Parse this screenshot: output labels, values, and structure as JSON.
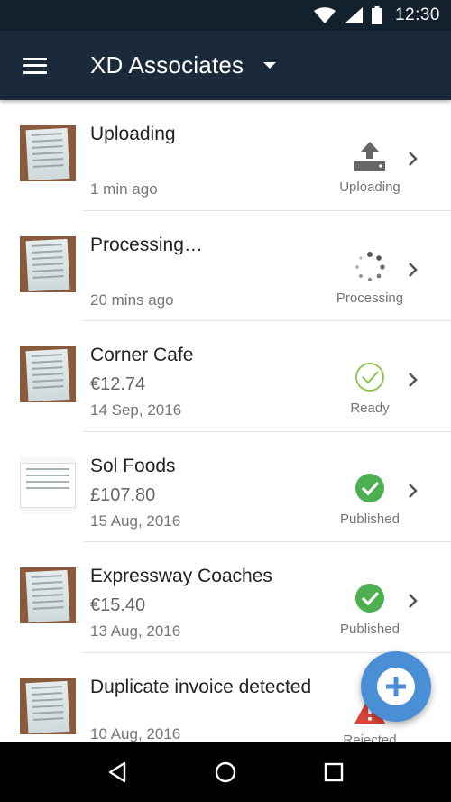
{
  "status_bar": {
    "time": "12:30"
  },
  "app_bar": {
    "title": "XD Associates"
  },
  "receipts": [
    {
      "title": "Uploading",
      "amount": "",
      "date": "1 min ago",
      "status": "Uploading",
      "status_icon": "upload-icon"
    },
    {
      "title": "Processing…",
      "amount": "",
      "date": "20 mins ago",
      "status": "Processing",
      "status_icon": "spinner-icon"
    },
    {
      "title": "Corner Cafe",
      "amount": "€12.74",
      "date": "14 Sep, 2016",
      "status": "Ready",
      "status_icon": "check-outline-icon"
    },
    {
      "title": "Sol Foods",
      "amount": "£107.80",
      "date": "15 Aug, 2016",
      "status": "Published",
      "status_icon": "check-filled-icon"
    },
    {
      "title": "Expressway Coaches",
      "amount": "€15.40",
      "date": "13 Aug, 2016",
      "status": "Published",
      "status_icon": "check-filled-icon"
    },
    {
      "title": "Duplicate invoice detected",
      "amount": "",
      "date": "10 Aug, 2016",
      "status": "Rejected",
      "status_icon": "warning-icon"
    }
  ],
  "colors": {
    "status_bar": "#13202e",
    "app_bar": "#1b2a3b",
    "published_green": "#4caf50",
    "ready_green": "#8bc34a",
    "rejected_red": "#d9443b",
    "fab_blue": "#4a8fd6"
  }
}
